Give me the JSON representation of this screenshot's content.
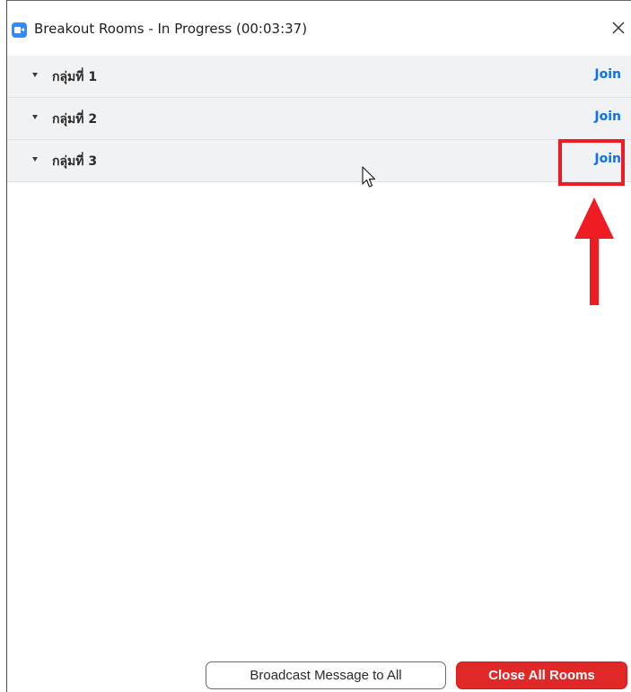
{
  "window": {
    "title": "Breakout Rooms - In Progress (00:03:37)",
    "app_icon": "zoom-video-icon",
    "close_icon": "close-icon"
  },
  "rooms": [
    {
      "label": "กลุ่มที่ 1",
      "action": "Join"
    },
    {
      "label": "กลุ่มที่ 2",
      "action": "Join"
    },
    {
      "label": "กลุ่มที่ 3",
      "action": "Join"
    }
  ],
  "footer": {
    "broadcast_label": "Broadcast Message to All",
    "close_all_label": "Close All Rooms"
  },
  "annotation": {
    "color": "#ef1c24",
    "icons": [
      "highlight-box",
      "up-arrow-icon"
    ]
  },
  "colors": {
    "link": "#0e71eb",
    "danger": "#e02828",
    "row_background": "#f1f2f4",
    "brand": "#2d8cff"
  }
}
